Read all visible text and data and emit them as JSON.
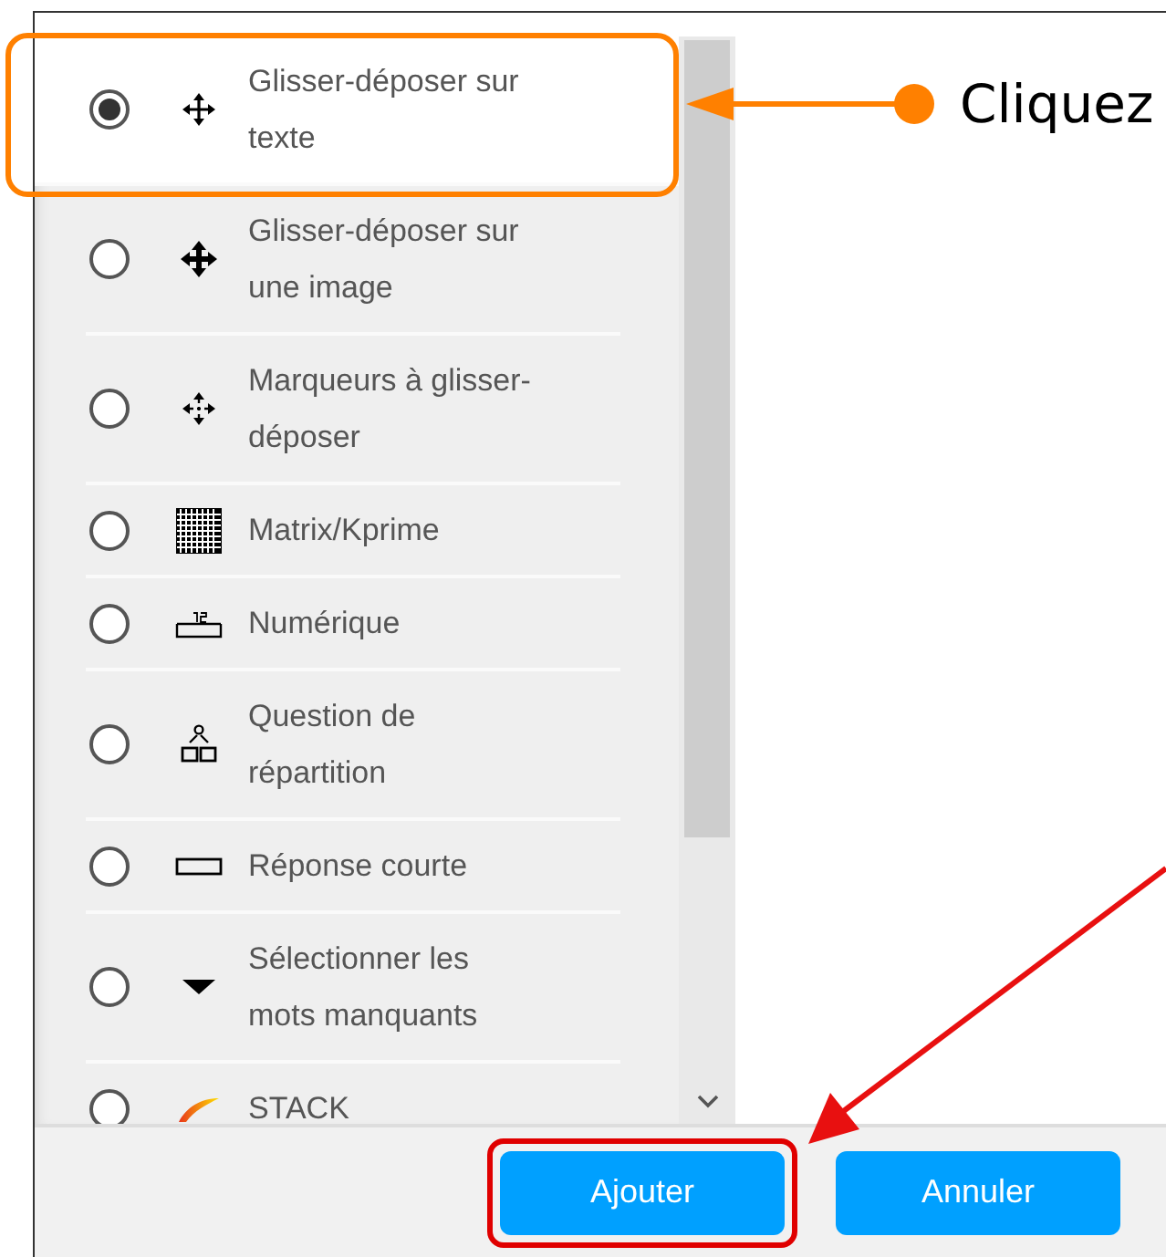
{
  "options": [
    {
      "label": "Glisser-déposer sur texte",
      "kind": "drag-text",
      "selected": true
    },
    {
      "label": "Glisser-déposer sur une image",
      "kind": "drag-image",
      "selected": false
    },
    {
      "label": "Marqueurs à glisser-déposer",
      "kind": "drag-markers",
      "selected": false
    },
    {
      "label": "Matrix/Kprime",
      "kind": "matrix",
      "selected": false
    },
    {
      "label": "Numérique",
      "kind": "numeric",
      "selected": false
    },
    {
      "label": "Question de répartition",
      "kind": "split",
      "selected": false
    },
    {
      "label": "Réponse courte",
      "kind": "short-answer",
      "selected": false
    },
    {
      "label": "Sélectionner les mots manquants",
      "kind": "select-missing",
      "selected": false
    },
    {
      "label": "STACK",
      "kind": "stack",
      "selected": false
    }
  ],
  "buttons": [
    {
      "label": "Ajouter",
      "highlighted": true
    },
    {
      "label": "Annuler",
      "highlighted": false
    }
  ],
  "callout": {
    "text": "Cliquez"
  }
}
